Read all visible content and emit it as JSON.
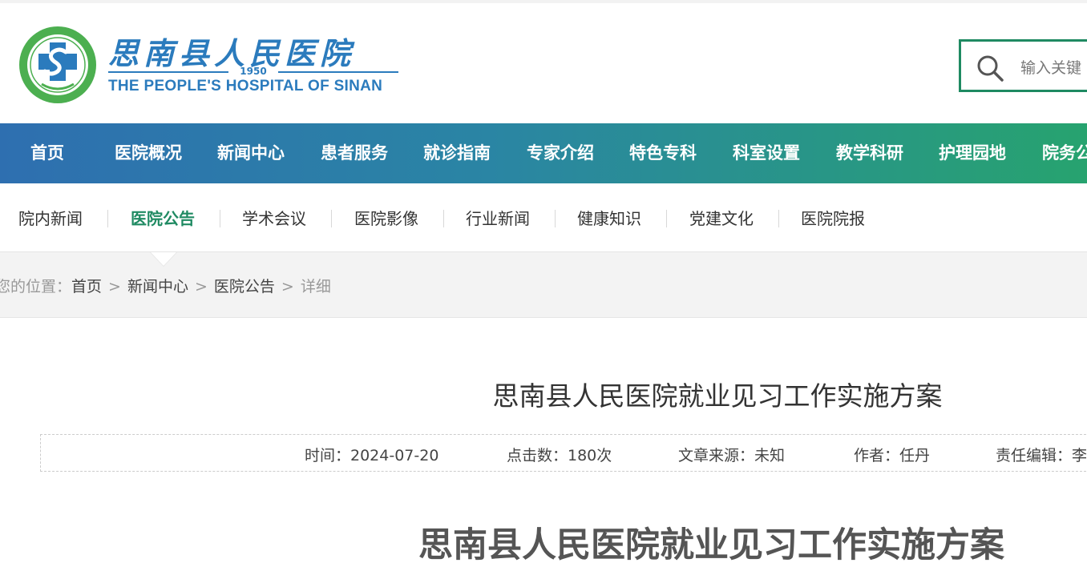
{
  "logo": {
    "name_cn": "思南县人民医院",
    "year": "1950",
    "name_en": "THE PEOPLE'S HOSPITAL OF SINAN"
  },
  "search": {
    "placeholder": "输入关键"
  },
  "main_nav": [
    "首页",
    "医院概况",
    "新闻中心",
    "患者服务",
    "就诊指南",
    "专家介绍",
    "特色专科",
    "科室设置",
    "教学科研",
    "护理园地",
    "院务公"
  ],
  "sub_nav": {
    "items": [
      "院内新闻",
      "医院公告",
      "学术会议",
      "医院影像",
      "行业新闻",
      "健康知识",
      "党建文化",
      "医院院报"
    ],
    "active": "医院公告"
  },
  "breadcrumb": {
    "label": "您的位置：",
    "links": [
      "首页",
      "新闻中心",
      "医院公告"
    ],
    "separator": ">",
    "current": "详细"
  },
  "article": {
    "title": "思南县人民医院就业见习工作实施方案",
    "meta": {
      "time": "时间：2024-07-20",
      "clicks": "点击数：180次",
      "source": "文章来源：未知",
      "author": "作者：任丹",
      "editor": "责任编辑：李"
    },
    "body_title": "思南县人民医院就业见习工作实施方案"
  },
  "colors": {
    "brand_blue": "#2b7bbd",
    "brand_green": "#1f8a62",
    "nav_gradient_start": "#2e6fb0",
    "nav_gradient_end": "#27a36f"
  }
}
